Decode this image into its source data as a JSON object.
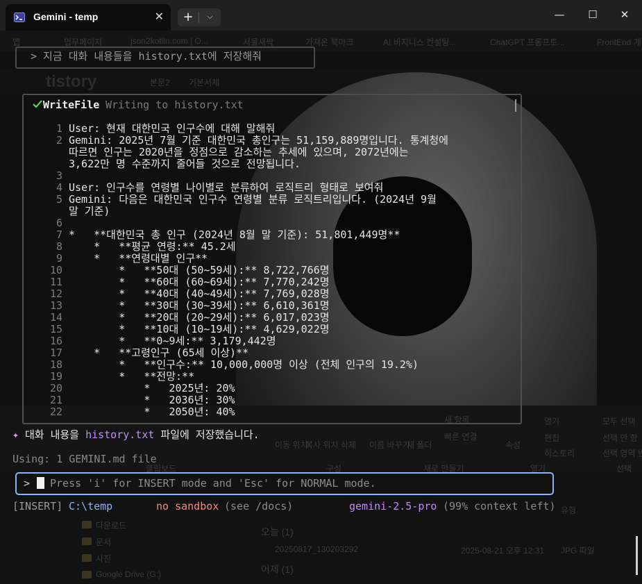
{
  "window": {
    "tab_title": "Gemini - temp",
    "tab_close": "✕",
    "new_tab": "+",
    "new_tab_dropdown": "⌵",
    "minimize": "—",
    "maximize": "☐",
    "close": "✕"
  },
  "background": {
    "bookmarks": [
      "앱",
      "업무페이지",
      "json2kotlin.com | O...",
      "서울새싹",
      "가져온 북마크",
      "AI 비지니스 컨설팅...",
      "ChatGPT 프롬프트...",
      "FrontEnd 개"
    ],
    "editor_logo": "tistory",
    "editor_items": [
      "본문2",
      "기본서체"
    ],
    "ribbon_items": [
      "이동 위치",
      "복사 위치",
      "삭제",
      "이름 바꾸기",
      "새 폴더",
      "속성",
      "열기",
      "편집",
      "히스토리",
      "모두 선택",
      "선택 안 함",
      "선택 영역 반전",
      "빠른 연결",
      "새 항목"
    ],
    "ribbon_groups": [
      "클립보드",
      "구성",
      "새로 만들기",
      "열기",
      "선택"
    ],
    "explorer_nav": [
      "다운로드",
      "문서",
      "사진",
      "Google Drive (G:)"
    ],
    "explorer_groups": [
      "오늘 (1)",
      "어제 (1)"
    ],
    "explorer_file": "20250817_130203292",
    "explorer_date": "2025-08-21 오후 12:31",
    "explorer_type": "JPG 파일",
    "explorer_header": "유형"
  },
  "user_message": "> 지금 대화 내용들을 history.txt에 저장해줘",
  "tool": {
    "name": "WriteFile",
    "description": "Writing to history.txt",
    "lines": [
      {
        "n": "1",
        "text": "User: 현재 대한민국 인구수에 대해 말해줘"
      },
      {
        "n": "2",
        "text": "Gemini: 2025년 7월 기준 대한민국 총인구는 51,159,889명입니다. 통계청에"
      },
      {
        "n": "",
        "text": "따르면 인구는 2020년을 정점으로 감소하는 추세에 있으며, 2072년에는"
      },
      {
        "n": "",
        "text": "3,622만 명 수준까지 줄어들 것으로 전망됩니다."
      },
      {
        "n": "3",
        "text": ""
      },
      {
        "n": "4",
        "text": "User: 인구수를 연령별 나이별로 분류하여 로직트리 형태로 보여줘"
      },
      {
        "n": "5",
        "text": "Gemini: 다음은 대한민국 인구수 연령별 분류 로직트리입니다. (2024년 9월"
      },
      {
        "n": "",
        "text": "말 기준)"
      },
      {
        "n": "6",
        "text": ""
      },
      {
        "n": "7",
        "text": "*   **대한민국 총 인구 (2024년 8월 말 기준): 51,801,449명**"
      },
      {
        "n": "8",
        "text": "    *   **평균 연령:** 45.2세"
      },
      {
        "n": "9",
        "text": "    *   **연령대별 인구**"
      },
      {
        "n": "10",
        "text": "        *   **50대 (50~59세):** 8,722,766명"
      },
      {
        "n": "11",
        "text": "        *   **60대 (60~69세):** 7,770,242명"
      },
      {
        "n": "12",
        "text": "        *   **40대 (40~49세):** 7,769,028명"
      },
      {
        "n": "13",
        "text": "        *   **30대 (30~39세):** 6,610,361명"
      },
      {
        "n": "14",
        "text": "        *   **20대 (20~29세):** 6,017,023명"
      },
      {
        "n": "15",
        "text": "        *   **10대 (10~19세):** 4,629,022명"
      },
      {
        "n": "16",
        "text": "        *   **0~9세:** 3,179,442명"
      },
      {
        "n": "17",
        "text": "    *   **고령인구 (65세 이상)**"
      },
      {
        "n": "18",
        "text": "        *   **인구수:** 10,000,000명 이상 (전체 인구의 19.2%)"
      },
      {
        "n": "19",
        "text": "        *   **전망:**"
      },
      {
        "n": "20",
        "text": "            *   2025년: 20%"
      },
      {
        "n": "21",
        "text": "            *   2036년: 30%"
      },
      {
        "n": "22",
        "text": "            *   2050년: 40%"
      }
    ]
  },
  "status": {
    "star": "✦",
    "before": "대화 내용을 ",
    "file": "history.txt",
    "after": " 파일에 저장했습니다."
  },
  "using": "Using: 1 GEMINI.md file",
  "input": {
    "prompt": ">",
    "placeholder": "Press 'i' for INSERT mode and 'Esc' for NORMAL mode."
  },
  "footer": {
    "mode": "[INSERT]",
    "directory": "C:\\temp",
    "sandbox": "no sandbox",
    "docs": "(see /docs)",
    "model": "gemini-2.5-pro",
    "context": "(99% context left)"
  },
  "colors": {
    "accent_blue": "#8ab4f8",
    "accent_purple": "#c58af9",
    "sandbox_red": "#f28b82",
    "check_green": "#5ad35a"
  }
}
